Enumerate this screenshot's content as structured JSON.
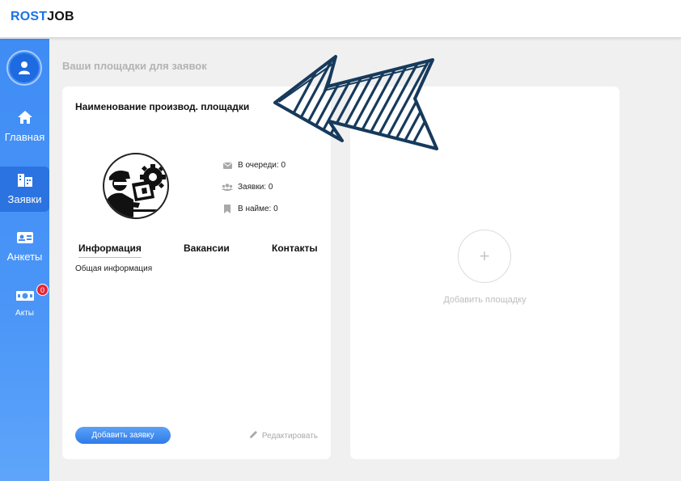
{
  "header": {
    "logo_part1": "ROST",
    "logo_part2": "JOB"
  },
  "sidebar": {
    "items": [
      {
        "label": "Главная",
        "icon": "home-icon",
        "active": false
      },
      {
        "label": "Заявки",
        "icon": "building-icon",
        "active": true
      },
      {
        "label": "Анкеты",
        "icon": "id-card-icon",
        "active": false
      },
      {
        "label": "Акты",
        "icon": "money-icon",
        "active": false,
        "badge": "0"
      }
    ]
  },
  "main": {
    "section_title": "Ваши площадки для заявок",
    "card": {
      "title": "Наименование производ. площадки",
      "stats": [
        {
          "icon": "envelope-icon",
          "label": "В очереди: 0"
        },
        {
          "icon": "users-icon",
          "label": "Заявки: 0"
        },
        {
          "icon": "bookmark-icon",
          "label": "В найме: 0"
        }
      ],
      "tabs": [
        "Информация",
        "Вакансии",
        "Контакты"
      ],
      "active_tab": "Информация",
      "tab_content": "Общая информация",
      "add_request_label": "Добавить заявку",
      "edit_label": "Редактировать"
    },
    "add_card": {
      "plus": "+",
      "label": "Добавить площадку"
    }
  },
  "colors": {
    "accent": "#3f8cf5",
    "badge": "#e5253a",
    "arrow": "#163a5c"
  }
}
